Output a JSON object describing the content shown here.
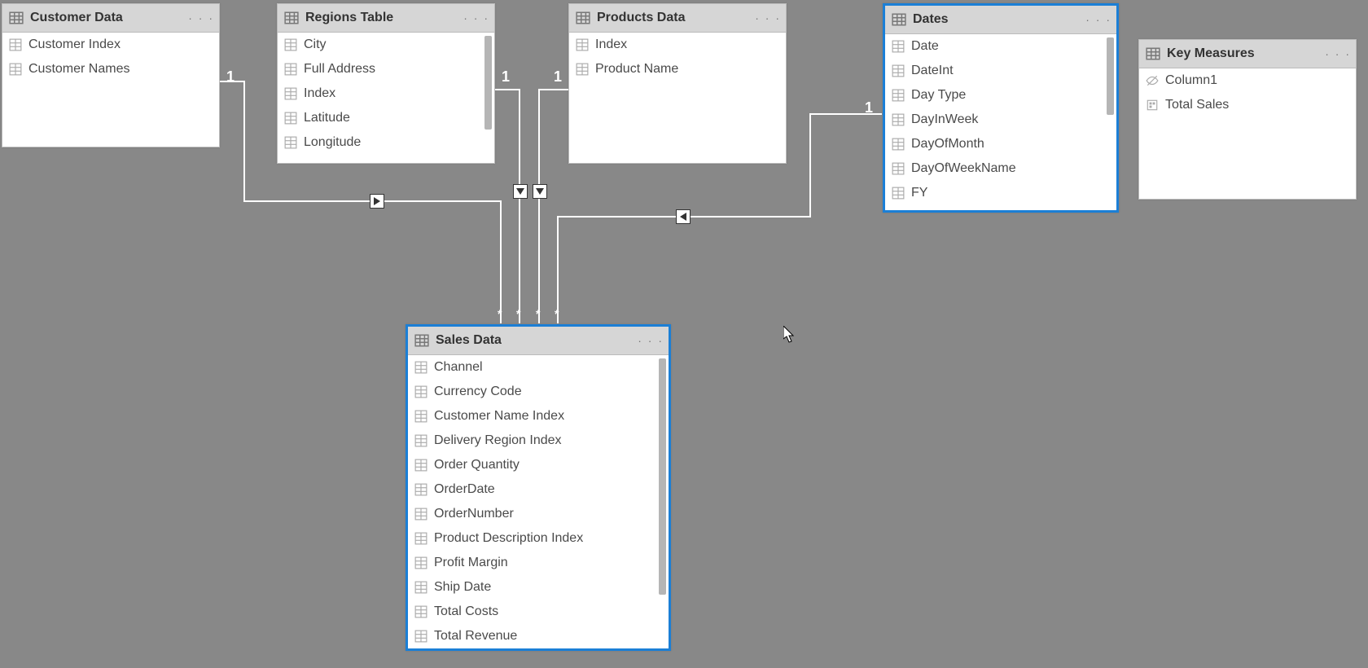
{
  "menu_glyph": "· · ·",
  "tables": {
    "customer": {
      "title": "Customer Data",
      "fields": [
        "Customer Index",
        "Customer Names"
      ]
    },
    "regions": {
      "title": "Regions Table",
      "fields": [
        "City",
        "Full Address",
        "Index",
        "Latitude",
        "Longitude"
      ]
    },
    "products": {
      "title": "Products Data",
      "fields": [
        "Index",
        "Product Name"
      ]
    },
    "dates": {
      "title": "Dates",
      "fields": [
        "Date",
        "DateInt",
        "Day Type",
        "DayInWeek",
        "DayOfMonth",
        "DayOfWeekName",
        "FY"
      ]
    },
    "measures": {
      "title": "Key Measures",
      "fields": [
        "Column1",
        "Total Sales"
      ]
    },
    "sales": {
      "title": "Sales Data",
      "fields": [
        "Channel",
        "Currency Code",
        "Customer Name Index",
        "Delivery Region Index",
        "Order Quantity",
        "OrderDate",
        "OrderNumber",
        "Product Description Index",
        "Profit Margin",
        "Ship Date",
        "Total Costs",
        "Total Revenue"
      ]
    }
  },
  "relationships": {
    "one_label": "1",
    "many_label": "*"
  }
}
